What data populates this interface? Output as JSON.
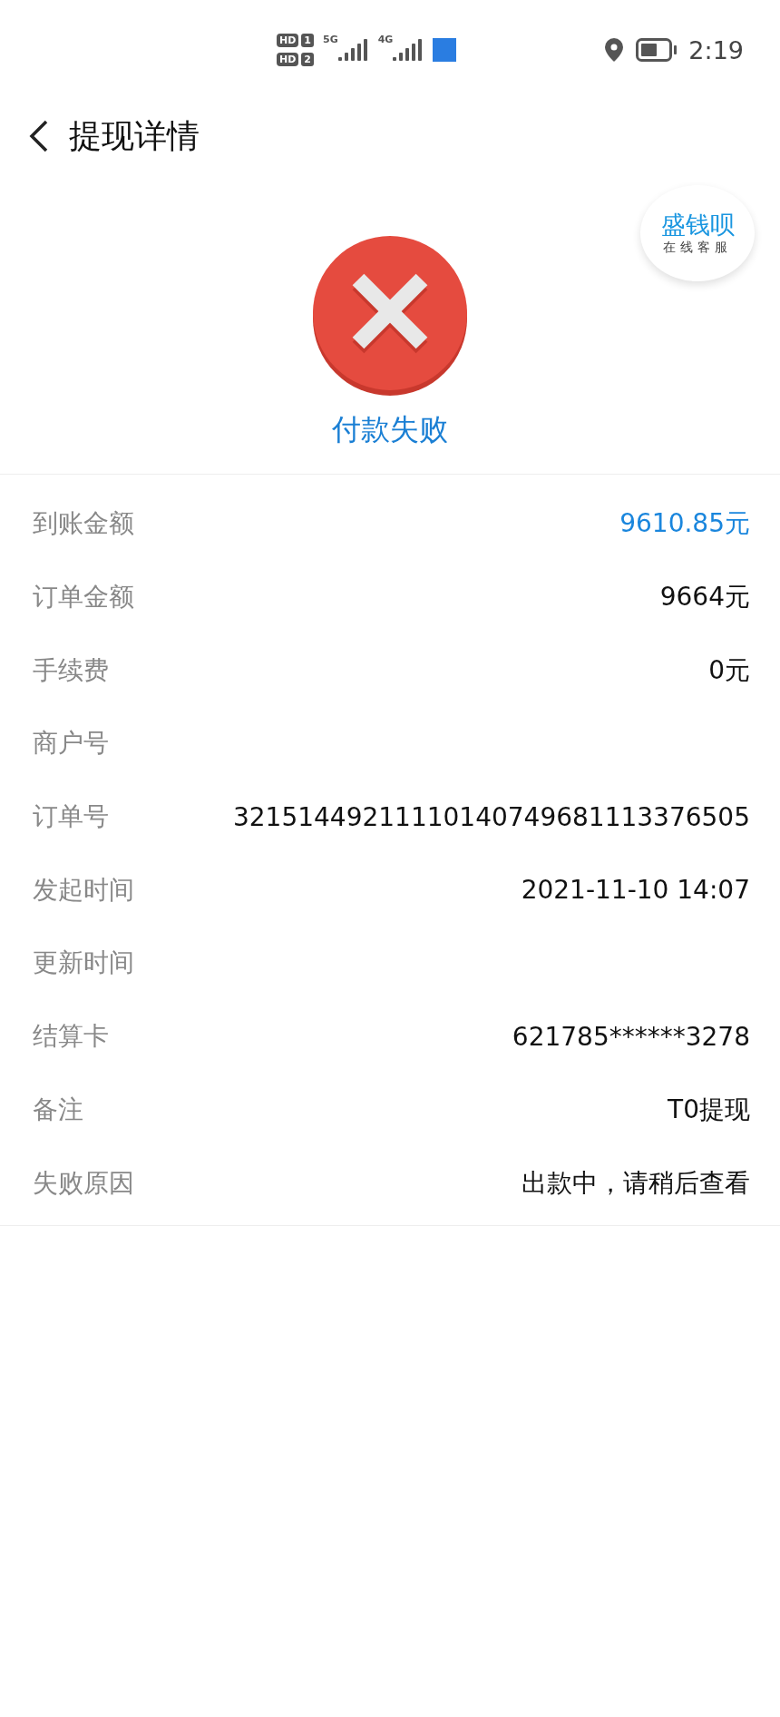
{
  "status_bar": {
    "sim_badges": [
      {
        "label": "HD",
        "slot": "1"
      },
      {
        "label": "HD",
        "slot": "2"
      }
    ],
    "networks": [
      "5G",
      "4G"
    ],
    "time": "2:19"
  },
  "header": {
    "title": "提现详情"
  },
  "support_bubble": {
    "brand": "盛钱呗",
    "label": "在线客服"
  },
  "result": {
    "kind": "failed",
    "status": "付款失败"
  },
  "details": [
    {
      "label": "到账金额",
      "value": "9610.85元",
      "highlight": true
    },
    {
      "label": "订单金额",
      "value": "9664元",
      "highlight": false
    },
    {
      "label": "手续费",
      "value": "0元",
      "highlight": false
    },
    {
      "label": "商户号"
    },
    {
      "label": "订单号",
      "value": "32151449211110140749681113376505",
      "highlight": false
    },
    {
      "label": "发起时间",
      "value": "2021-11-10 14:07",
      "highlight": false
    },
    {
      "label": "更新时间"
    },
    {
      "label": "结算卡",
      "value": "621785******3278",
      "highlight": false
    },
    {
      "label": "备注",
      "value": "T0提现",
      "highlight": false
    },
    {
      "label": "失败原因",
      "value": "出款中，请稍后查看",
      "highlight": false
    }
  ]
}
